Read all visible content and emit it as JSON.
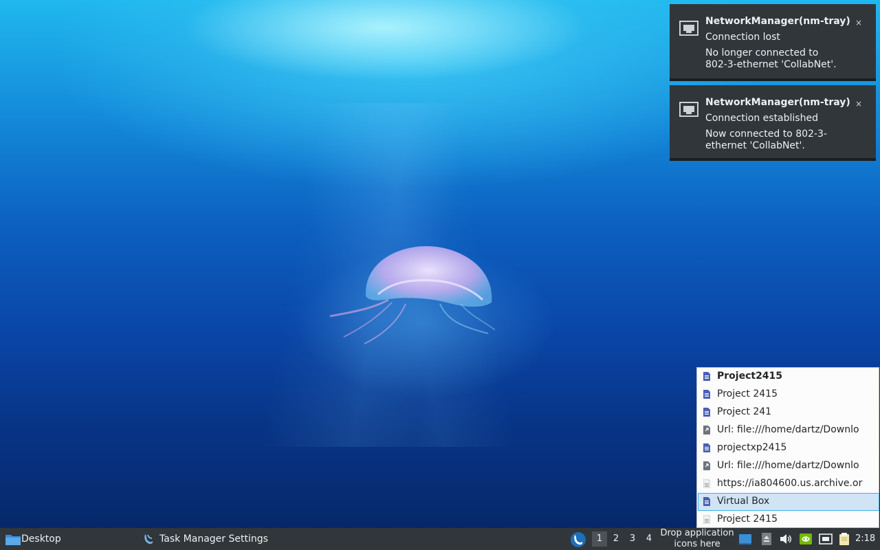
{
  "notifications": [
    {
      "icon": "ethernet-icon",
      "app": "NetworkManager(nm-tray)",
      "summary": "Connection lost",
      "body_line1": "No longer connected to",
      "body_line2": "802-3-ethernet 'CollabNet'.",
      "close": "×"
    },
    {
      "icon": "ethernet-icon",
      "app": "NetworkManager(nm-tray)",
      "summary": "Connection established",
      "body_line1": "Now connected to 802-3-",
      "body_line2": "ethernet 'CollabNet'.",
      "close": "×"
    }
  ],
  "recent_list": {
    "items": [
      {
        "label": "Project2415",
        "icon": "document-icon",
        "bold": true
      },
      {
        "label": "Project 2415",
        "icon": "document-icon"
      },
      {
        "label": "Project 241",
        "icon": "document-icon"
      },
      {
        "label": "Url: file:///home/dartz/Downlo",
        "icon": "link-file-icon"
      },
      {
        "label": "projectxp2415",
        "icon": "document-icon"
      },
      {
        "label": "Url: file:///home/dartz/Downlo",
        "icon": "link-file-icon"
      },
      {
        "label": "https://ia804600.us.archive.or",
        "icon": "text-file-icon"
      },
      {
        "label": "Virtual Box",
        "icon": "document-icon",
        "selected": true
      },
      {
        "label": "Project 2415",
        "icon": "text-file-icon"
      }
    ]
  },
  "taskbar": {
    "desktop_label": "Desktop",
    "task_label": "Task Manager Settings",
    "workspaces": [
      "1",
      "2",
      "3",
      "4"
    ],
    "active_workspace": "1",
    "drop_line1": "Drop application",
    "drop_line2": "icons here",
    "clock": "2:18",
    "tray_icons": [
      "show-desktop-icon",
      "removable-media-icon",
      "volume-icon",
      "nvidia-icon",
      "network-icon",
      "clipboard-icon"
    ]
  },
  "colors": {
    "panel": "#31363b",
    "selection": "#3daee9",
    "document_icon": "#4a5fb5"
  }
}
